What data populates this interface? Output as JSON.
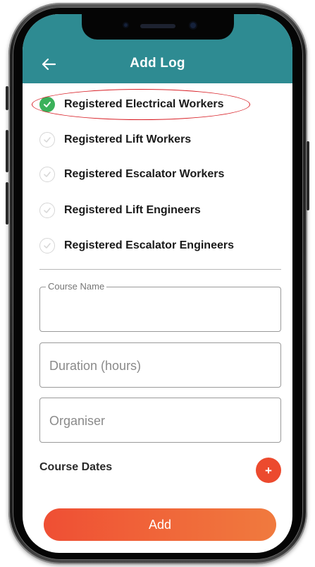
{
  "header": {
    "title": "Add Log",
    "back_icon": "arrow-left-icon",
    "color": "#2e8b92"
  },
  "categories": [
    {
      "label": "Registered Electrical Workers",
      "checked": true
    },
    {
      "label": "Registered Lift Workers",
      "checked": false
    },
    {
      "label": "Registered Escalator Workers",
      "checked": false
    },
    {
      "label": "Registered Lift Engineers",
      "checked": false
    },
    {
      "label": "Registered Escalator Engineers",
      "checked": false
    }
  ],
  "form": {
    "course_name": {
      "label": "Course Name",
      "value": ""
    },
    "duration": {
      "placeholder": "Duration (hours)",
      "value": ""
    },
    "organiser": {
      "placeholder": "Organiser",
      "value": ""
    }
  },
  "course_dates": {
    "label": "Course Dates",
    "add_symbol": "+"
  },
  "submit": {
    "label": "Add"
  },
  "colors": {
    "check_on": "#3bb15a",
    "accent": "#ec4a2e",
    "highlight": "#d81f26"
  }
}
